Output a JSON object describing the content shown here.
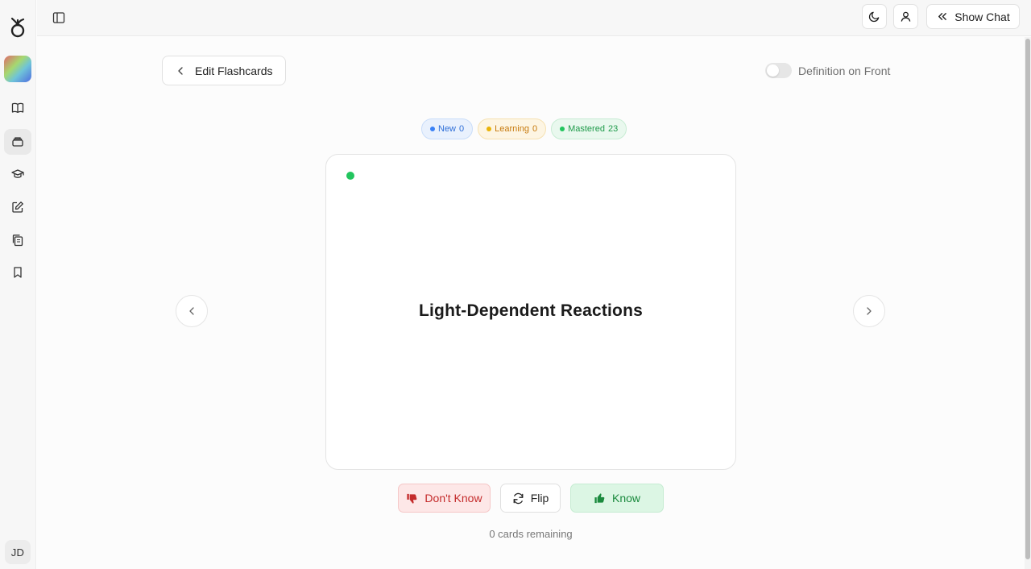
{
  "sidebar": {
    "items": [
      {
        "icon": "book-icon"
      },
      {
        "icon": "cards-icon"
      },
      {
        "icon": "graduation-cap-icon"
      },
      {
        "icon": "pencil-square-icon"
      },
      {
        "icon": "copy-icon"
      },
      {
        "icon": "bookmark-icon"
      }
    ],
    "avatar_initials": "JD"
  },
  "topbar": {
    "show_chat_label": "Show Chat"
  },
  "flashcards": {
    "edit_label": "Edit Flashcards",
    "toggle_label": "Definition on Front",
    "toggle_on": false,
    "badges": {
      "new_label": "New",
      "new_count": "0",
      "learning_label": "Learning",
      "learning_count": "0",
      "mastered_label": "Mastered",
      "mastered_count": "23"
    },
    "card_term": "Light-Dependent Reactions",
    "dont_know_label": "Don't Know",
    "flip_label": "Flip",
    "know_label": "Know",
    "remaining_text": "0 cards remaining"
  },
  "colors": {
    "new": "#3b82f6",
    "learning": "#eab308",
    "mastered": "#22c55e",
    "dont_know": "#c42b2b",
    "know": "#1b8a3e"
  }
}
